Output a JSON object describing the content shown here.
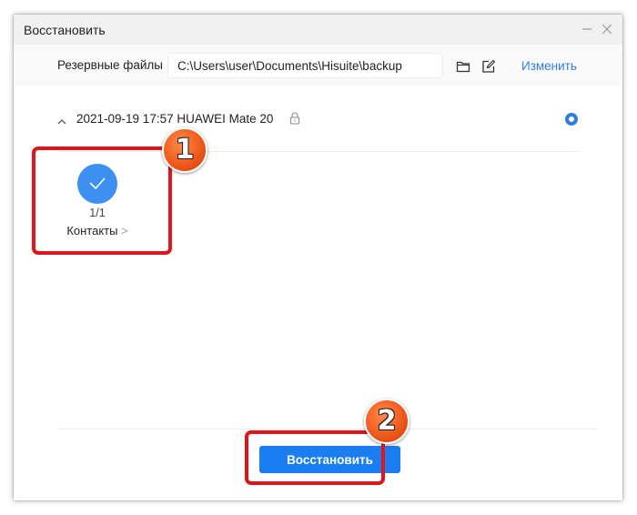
{
  "window": {
    "title": "Восстановить"
  },
  "path_row": {
    "label": "Резервные файлы",
    "path_value": "C:\\Users\\user\\Documents\\Hisuite\\backup",
    "change_link": "Изменить"
  },
  "backup": {
    "label": "2021-09-19 17:57 HUAWEI Mate 20",
    "selected": true
  },
  "category": {
    "count": "1/1",
    "name": "Контакты",
    "arrow": ">"
  },
  "actions": {
    "restore_button": "Восстановить"
  },
  "annotations": {
    "step_1": "1",
    "step_2": "2"
  },
  "colors": {
    "accent": "#2f7de1",
    "button": "#1a7ef2",
    "check": "#3d8ff0",
    "highlight": "#e0141a",
    "badge": "#f05a1c"
  }
}
